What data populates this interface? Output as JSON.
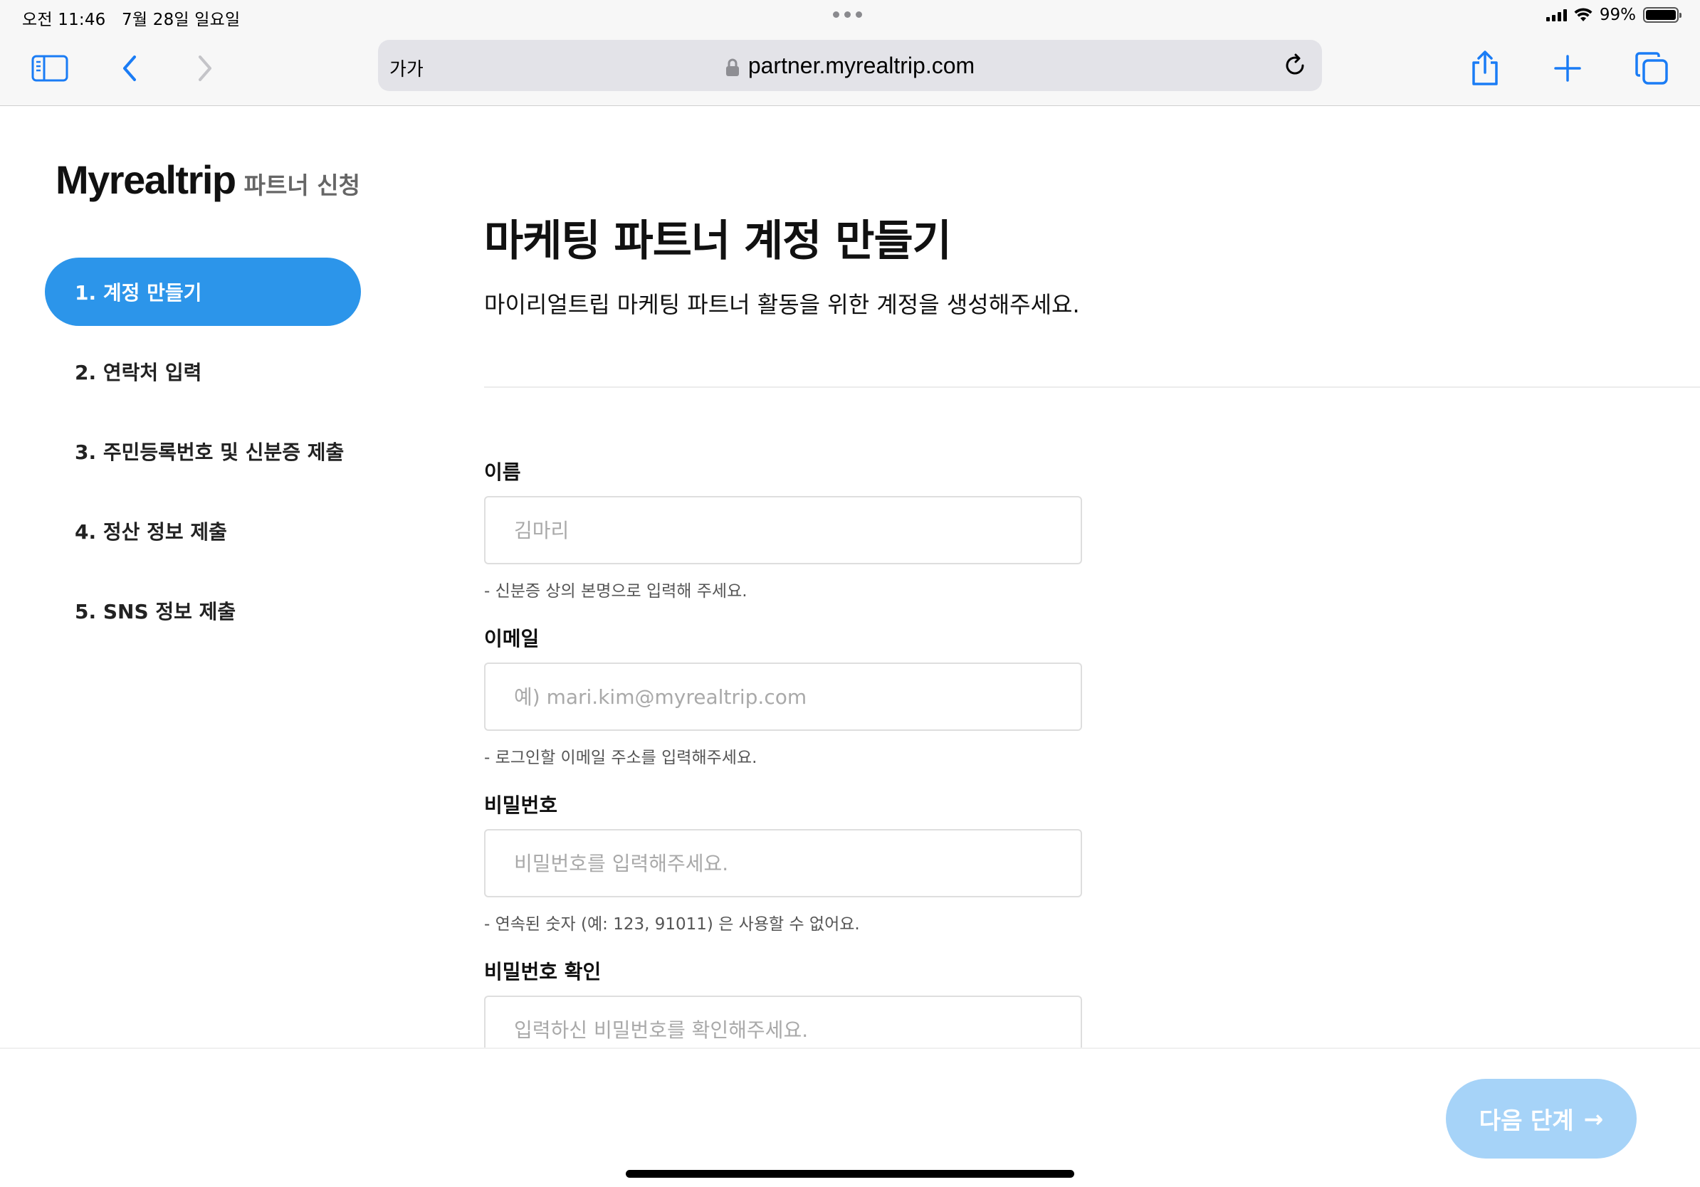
{
  "status": {
    "time": "오전 11:46   7월 28일 일요일",
    "battery": "99%"
  },
  "browser": {
    "text_size_button": "가가",
    "url": "partner.myrealtrip.com"
  },
  "brand": {
    "logo": "Myrealtrip",
    "subtitle": "파트너 신청"
  },
  "steps": [
    {
      "label": "1. 계정 만들기",
      "active": true
    },
    {
      "label": "2. 연락처 입력",
      "active": false
    },
    {
      "label": "3. 주민등록번호 및 신분증 제출",
      "active": false
    },
    {
      "label": "4. 정산 정보 제출",
      "active": false
    },
    {
      "label": "5. SNS 정보 제출",
      "active": false
    }
  ],
  "header": {
    "title": "마케팅 파트너 계정 만들기",
    "subtitle": "마이리얼트립 마케팅 파트너 활동을 위한 계정을 생성해주세요."
  },
  "form": {
    "name": {
      "label": "이름",
      "placeholder": "김마리",
      "value": "",
      "help": "- 신분증 상의 본명으로 입력해 주세요."
    },
    "email": {
      "label": "이메일",
      "placeholder": "예) mari.kim@myrealtrip.com",
      "value": "",
      "help": "- 로그인할 이메일 주소를 입력해주세요."
    },
    "password": {
      "label": "비밀번호",
      "placeholder": "비밀번호를 입력해주세요.",
      "value": "",
      "help": "- 연속된 숫자 (예: 123, 91011) 은 사용할 수 없어요."
    },
    "password_confirm": {
      "label": "비밀번호 확인",
      "placeholder": "입력하신 비밀번호를 확인해주세요.",
      "value": ""
    }
  },
  "footer": {
    "next_label": "다음 단계",
    "next_arrow": "→"
  },
  "colors": {
    "accent": "#2c95ea",
    "disabled_button": "#a6d3f8"
  }
}
